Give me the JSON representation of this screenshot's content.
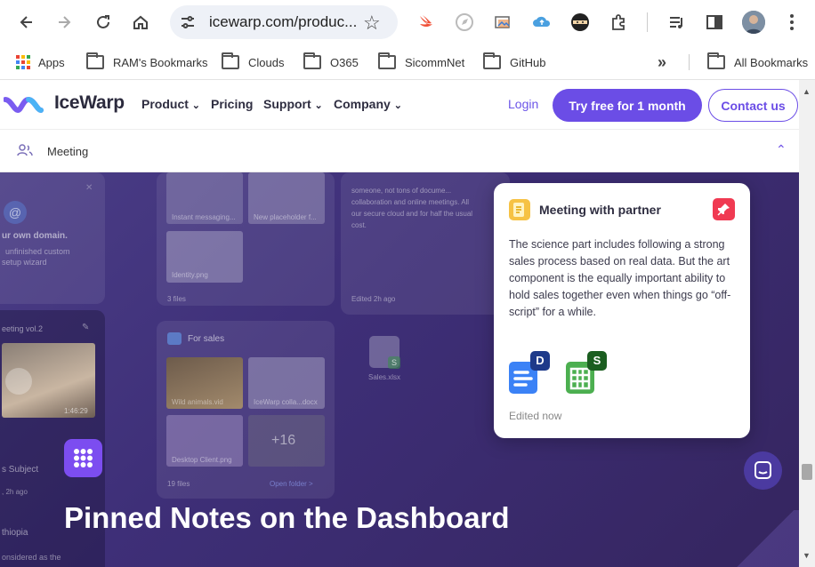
{
  "browser": {
    "url": "icewarp.com/produc...",
    "bookmarks": [
      "Apps",
      "RAM's Bookmarks",
      "Clouds",
      "O365",
      "SicommNet",
      "GitHub"
    ],
    "all_bookmarks": "All Bookmarks",
    "icons": [
      "back-icon",
      "forward-icon",
      "reload-icon",
      "home-icon",
      "site-settings-icon",
      "star-icon",
      "swift-icon",
      "compass-icon",
      "gallery-icon",
      "cloud-upload-icon",
      "ninja-icon",
      "extensions-icon",
      "media-icon",
      "side-panel-icon",
      "profile-avatar",
      "more-menu-icon"
    ]
  },
  "site": {
    "logo": "IceWarp",
    "nav": [
      "Product",
      "Pricing",
      "Support",
      "Company"
    ],
    "login": "Login",
    "try_free": "Try free for 1 month",
    "contact": "Contact us",
    "subnav_label": "Meeting",
    "accent": "#6b4de6"
  },
  "hero": {
    "heading": "Pinned Notes on the Dashboard",
    "left_panel": {
      "domain_title": "ur own domain.",
      "domain_desc_1": "unfinished custom",
      "domain_desc_2": "setup wizard",
      "meeting_title": "eeting vol.2",
      "video_time": "1:46:29",
      "subject": "s Subject",
      "time_ago": ", 2h ago",
      "ethiopia": "thiopia",
      "considered": "onsidered as the"
    },
    "files_panel": {
      "instant": "Instant messaging...",
      "placeholder": "New placeholder f...",
      "identity": "Identity.png",
      "files_count": "3 files",
      "for_sales": "For sales",
      "wild": "Wild animals.vid",
      "collab": "IceWarp colla...docx",
      "desktop": "Desktop Client.png",
      "plus": "+16",
      "files_19": "19 files",
      "open_folder": "Open folder >",
      "sales_file": "Sales.xlsx",
      "edited_ago": "Edited 2h ago",
      "doc_text_1": "someone, not tons of docume...",
      "doc_text_2": "collaboration and online meetings. All",
      "doc_text_3": "our secure cloud and for half the usual",
      "doc_text_4": "cost."
    },
    "note_card": {
      "title": "Meeting with partner",
      "body": "The science part includes following a strong sales process based on real data. But the art component is the equally important ability to hold sales together even when things go “off-script” for a while.",
      "doc_badge": "D",
      "sheet_badge": "S",
      "edited": "Edited now"
    }
  }
}
